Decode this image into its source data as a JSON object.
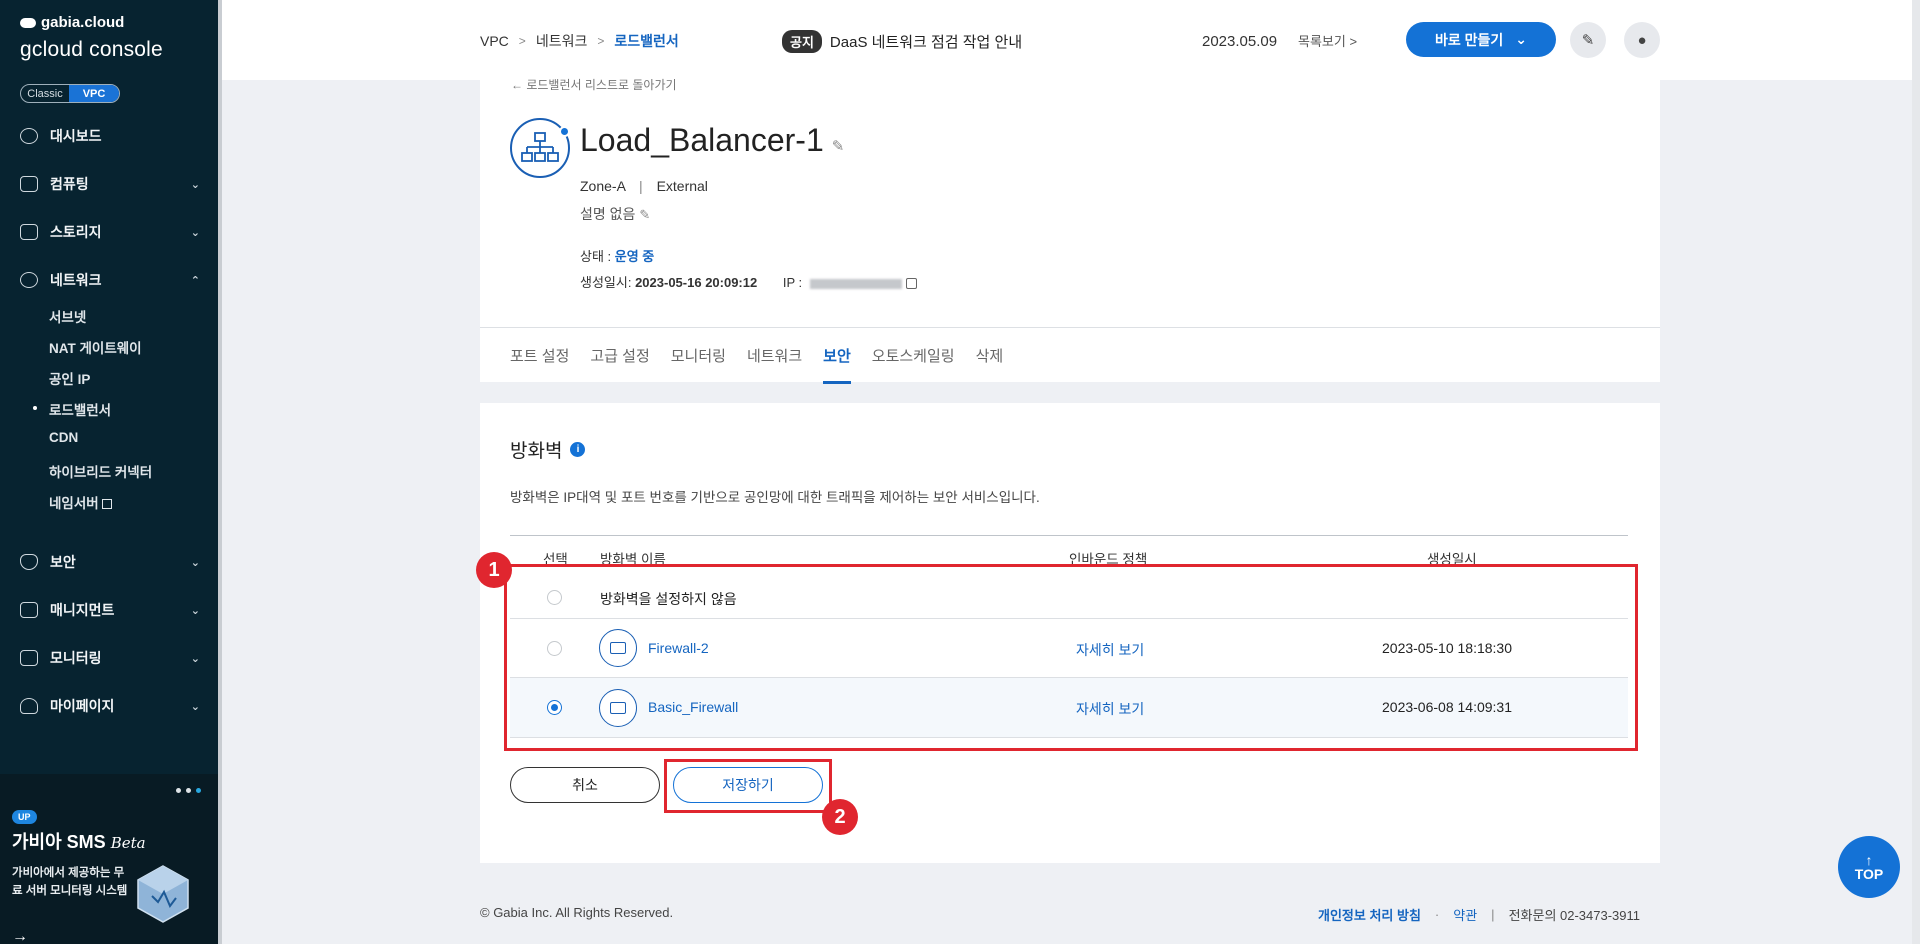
{
  "sidebar": {
    "brand_top": "gabia.cloud",
    "brand_main": "gcloud console",
    "toggle": {
      "classic": "Classic",
      "vpc": "VPC"
    },
    "nav": [
      {
        "label": "대시보드",
        "chevron": ""
      },
      {
        "label": "컴퓨팅",
        "chevron": "⌄"
      },
      {
        "label": "스토리지",
        "chevron": "⌄"
      },
      {
        "label": "네트워크",
        "chevron": "⌃"
      },
      {
        "label": "보안",
        "chevron": "⌄"
      },
      {
        "label": "매니지먼트",
        "chevron": "⌄"
      },
      {
        "label": "모니터링",
        "chevron": "⌄"
      },
      {
        "label": "마이페이지",
        "chevron": "⌄"
      }
    ],
    "network_sub": [
      "서브넷",
      "NAT 게이트웨이",
      "공인 IP",
      "로드밸런서",
      "CDN",
      "하이브리드 커넥터",
      "네임서버"
    ],
    "promo": {
      "badge": "UP",
      "title": "가비아 SMS",
      "title_suffix": "Beta",
      "desc": "가비아에서 제공하는 무료 서버 모니터링 시스템",
      "arrow": "→"
    }
  },
  "header": {
    "breadcrumb": [
      "VPC",
      "네트워크",
      "로드밸런서"
    ],
    "notice_tag": "공지",
    "notice_text": "DaaS 네트워크 점검 작업 안내",
    "notice_date": "2023.05.09",
    "notice_list": "목록보기",
    "create_button": "바로 만들기"
  },
  "detail": {
    "back_link": "← 로드밸런서 리스트로 돌아가기",
    "name": "Load_Balancer-1",
    "zone": "Zone-A",
    "type": "External",
    "description": "설명 없음",
    "status_label": "상태 : ",
    "status_value": "운영 중",
    "created_label": "생성일시: ",
    "created_value": "2023-05-16 20:09:12",
    "ip_label": "IP : "
  },
  "tabs": [
    "포트 설정",
    "고급 설정",
    "모니터링",
    "네트워크",
    "보안",
    "오토스케일링",
    "삭제"
  ],
  "firewall": {
    "title": "방화벽",
    "desc": "방화벽은 IP대역 및 포트 번호를 기반으로 공인망에 대한 트래픽을 제어하는 보안 서비스입니다.",
    "columns": {
      "select": "선택",
      "name": "방화벽 이름",
      "inbound": "인바운드 정책",
      "created": "생성일시"
    },
    "rows": [
      {
        "name": "방화벽을 설정하지 않음",
        "inbound": "",
        "created": "",
        "selected": false
      },
      {
        "name": "Firewall-2",
        "inbound": "자세히 보기",
        "created": "2023-05-10 18:18:30",
        "selected": false
      },
      {
        "name": "Basic_Firewall",
        "inbound": "자세히 보기",
        "created": "2023-06-08 14:09:31",
        "selected": true
      }
    ],
    "cancel": "취소",
    "save": "저장하기"
  },
  "annotations": {
    "first": "1",
    "second": "2"
  },
  "footer": {
    "copyright": "© Gabia Inc. All Rights Reserved.",
    "privacy": "개인정보 처리 방침",
    "dot": "·",
    "terms": "약관",
    "bar": "|",
    "contact": "전화문의  02-3473-3911"
  },
  "top_button": "TOP",
  "colors": {
    "accent": "#1472d6",
    "sidebar": "#072330",
    "annotation": "#e0262f"
  }
}
